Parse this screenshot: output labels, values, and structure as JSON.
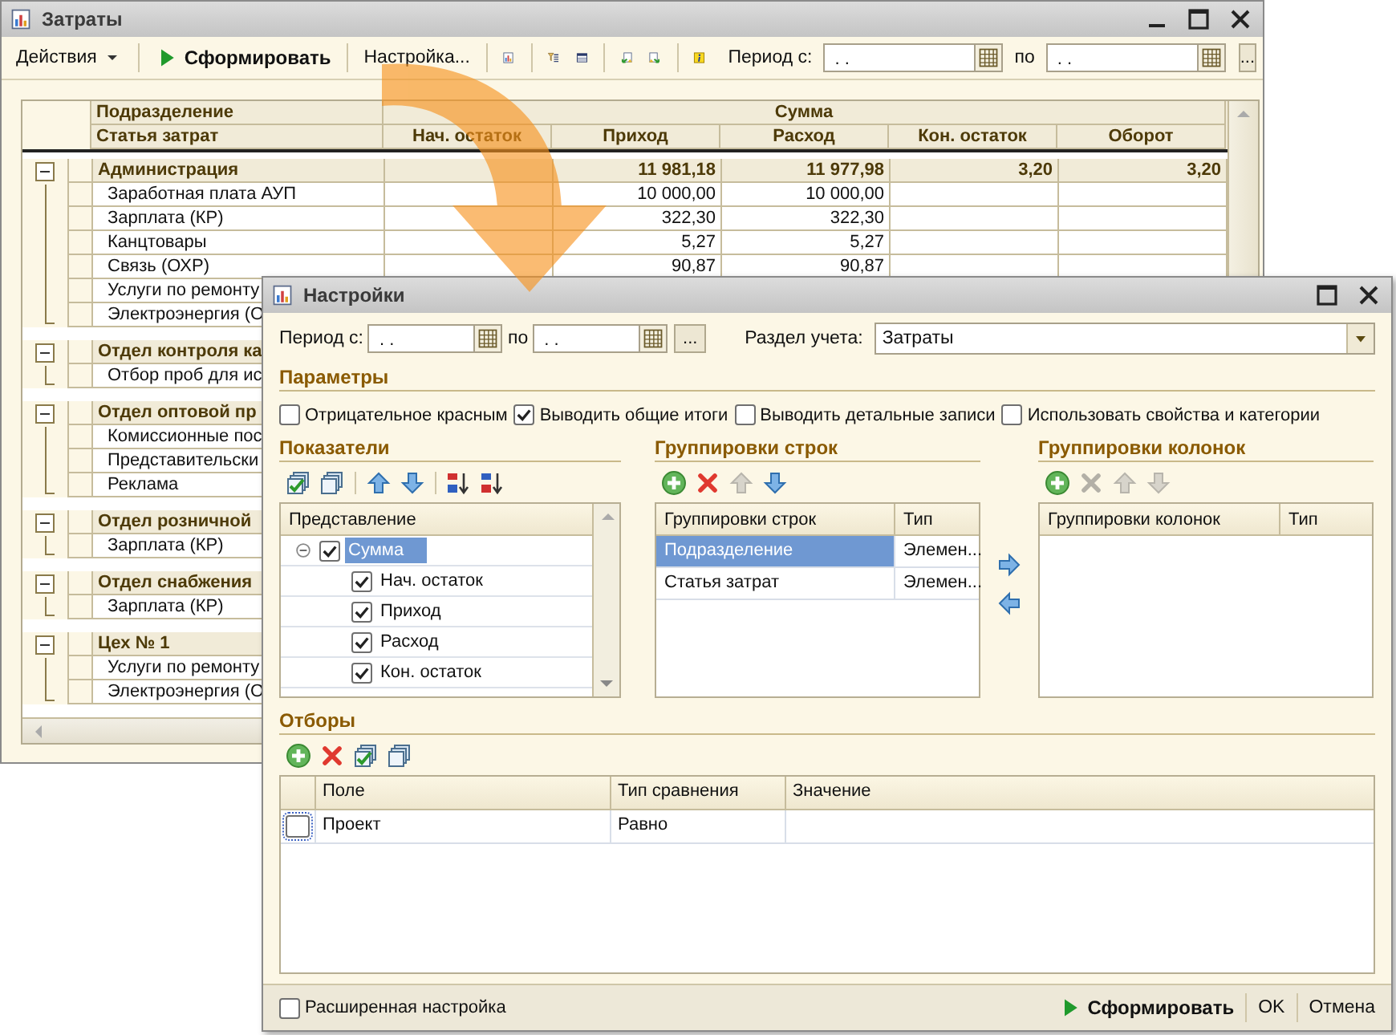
{
  "main_window": {
    "title": "Затраты",
    "toolbar": {
      "actions_menu": "Действия",
      "generate": "Сформировать",
      "settings": "Настройка...",
      "period_label": "Период с:",
      "period_from": ". .",
      "to_label": "по",
      "period_to": ". .",
      "more": "..."
    },
    "table": {
      "group_header": "Подразделение",
      "item_header": "Статья затрат",
      "sum_header": "Сумма",
      "columns": [
        "Нач. остаток",
        "Приход",
        "Расход",
        "Кон. остаток",
        "Оборот"
      ],
      "groups": [
        {
          "name": "Администрация",
          "expanded": true,
          "income": "11 981,18",
          "expense": "11 977,98",
          "closing": "3,20",
          "turnover": "3,20",
          "rows": [
            {
              "name": "Заработная плата АУП",
              "income": "10 000,00",
              "expense": "10 000,00"
            },
            {
              "name": "Зарплата (КР)",
              "income": "322,30",
              "expense": "322,30"
            },
            {
              "name": "Канцтовары",
              "income": "5,27",
              "expense": "5,27"
            },
            {
              "name": "Связь (ОХР)",
              "income": "90,87",
              "expense": "90,87"
            },
            {
              "name": "Услуги по ремонту"
            },
            {
              "name": "Электроэнергия (О"
            }
          ]
        },
        {
          "name": "Отдел контроля ка",
          "expanded": true,
          "rows": [
            {
              "name": "Отбор проб для ис"
            }
          ]
        },
        {
          "name": "Отдел оптовой пр",
          "expanded": true,
          "rows": [
            {
              "name": "Комиссионные пос"
            },
            {
              "name": "Представительски"
            },
            {
              "name": "Реклама"
            }
          ]
        },
        {
          "name": "Отдел розничной",
          "expanded": true,
          "rows": [
            {
              "name": "Зарплата (КР)"
            }
          ]
        },
        {
          "name": "Отдел снабжения",
          "expanded": true,
          "rows": [
            {
              "name": "Зарплата (КР)"
            }
          ]
        },
        {
          "name": "Цех № 1",
          "expanded": true,
          "rows": [
            {
              "name": "Услуги по ремонту"
            },
            {
              "name": "Электроэнергия (О"
            }
          ]
        }
      ]
    }
  },
  "settings_dialog": {
    "title": "Настройки",
    "period_label": "Период с:",
    "period_from": ". .",
    "to_label": "по",
    "period_to": ". .",
    "more": "...",
    "section_label": "Раздел учета:",
    "section_value": "Затраты",
    "parameters": {
      "title": "Параметры",
      "options": [
        {
          "label": "Отрицательное красным",
          "checked": false
        },
        {
          "label": "Выводить общие итоги",
          "checked": true
        },
        {
          "label": "Выводить детальные записи",
          "checked": false
        },
        {
          "label": "Использовать свойства и категории",
          "checked": false
        }
      ]
    },
    "indicators": {
      "title": "Показатели",
      "tools": [
        {
          "kind": "check-all",
          "disabled": false
        },
        {
          "kind": "uncheck-all",
          "disabled": false
        },
        {
          "kind": "up",
          "disabled": false
        },
        {
          "kind": "down",
          "disabled": false
        },
        {
          "kind": "sort-asc",
          "disabled": false
        },
        {
          "kind": "sort-desc",
          "disabled": false
        }
      ],
      "column": "Представление",
      "items": [
        {
          "label": "Сумма",
          "checked": true,
          "selected": true,
          "expanded": true,
          "children": [
            {
              "label": "Нач. остаток",
              "checked": true,
              "selected": false
            },
            {
              "label": "Приход",
              "checked": true,
              "selected": false
            },
            {
              "label": "Расход",
              "checked": true,
              "selected": false
            },
            {
              "label": "Кон. остаток",
              "checked": true,
              "selected": false
            }
          ]
        }
      ]
    },
    "row_groupings": {
      "title": "Группировки строк",
      "tools": [
        {
          "kind": "add",
          "disabled": false
        },
        {
          "kind": "delete",
          "disabled": false
        },
        {
          "kind": "up",
          "disabled": true
        },
        {
          "kind": "down",
          "disabled": false
        }
      ],
      "columns": [
        "Группировки строк",
        "Тип"
      ],
      "rows": [
        {
          "field": "Подразделение",
          "type": "Элемен...",
          "selected": true
        },
        {
          "field": "Статья затрат",
          "type": "Элемен...",
          "selected": false
        }
      ]
    },
    "column_groupings": {
      "title": "Группировки колонок",
      "tools": [
        {
          "kind": "add",
          "disabled": false
        },
        {
          "kind": "delete",
          "disabled": true
        },
        {
          "kind": "up",
          "disabled": true
        },
        {
          "kind": "down",
          "disabled": true
        }
      ],
      "columns": [
        "Группировки колонок",
        "Тип"
      ]
    },
    "filters": {
      "title": "Отборы",
      "tools": [
        {
          "kind": "add",
          "disabled": false
        },
        {
          "kind": "delete",
          "disabled": false
        },
        {
          "kind": "check-all",
          "disabled": false
        },
        {
          "kind": "uncheck-all",
          "disabled": false
        }
      ],
      "columns": [
        "Поле",
        "Тип сравнения",
        "Значение"
      ],
      "rows": [
        {
          "checked": false,
          "field": "Проект",
          "comparison": "Равно"
        }
      ]
    },
    "footer": {
      "extended": {
        "label": "Расширенная настройка",
        "checked": false
      },
      "buttons": [
        {
          "kind": "primary",
          "label": "Сформировать"
        },
        {
          "kind": "plain",
          "label": "OK"
        },
        {
          "kind": "plain",
          "label": "Отмена"
        }
      ]
    }
  }
}
